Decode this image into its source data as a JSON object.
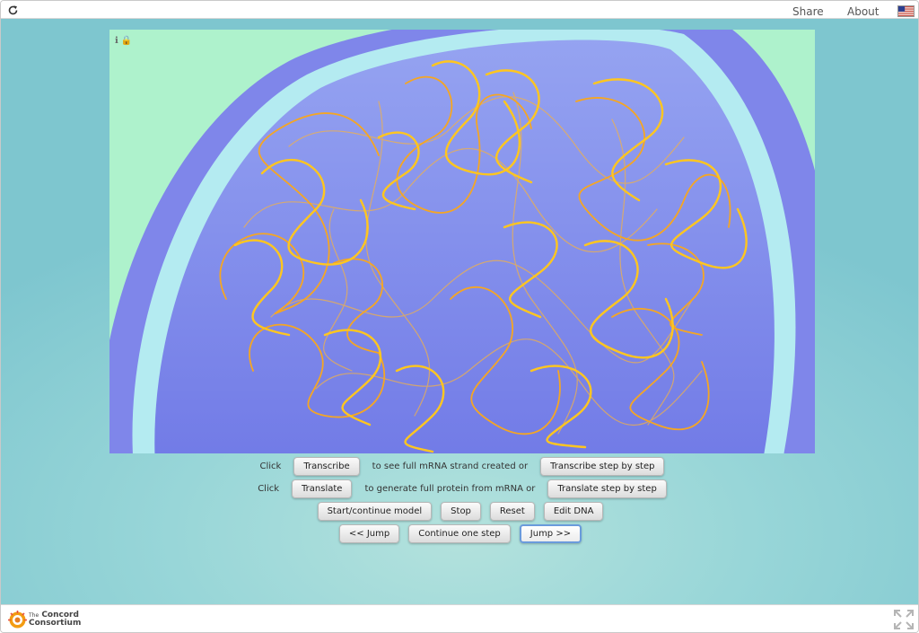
{
  "topbar": {
    "share_label": "Share",
    "about_label": "About",
    "reload_icon": "reload-icon",
    "language_icon": "us-flag-icon"
  },
  "canvas": {
    "background": "#aef2cc",
    "outer_membrane_color": "#7f86ea",
    "inner_membrane_color": "#b4ebf1",
    "nucleus_gradient": [
      "#95a3f1",
      "#7079e6"
    ],
    "dna_colors": [
      "#ffc61f",
      "#f5a623",
      "#f0b14a"
    ],
    "tool_icons": [
      "info-icon",
      "lock-icon"
    ]
  },
  "controls": {
    "row1": {
      "prefix": "Click",
      "transcribe_label": "Transcribe",
      "middle": "to see full mRNA strand created or",
      "transcribe_step_label": "Transcribe step by step"
    },
    "row2": {
      "prefix": "Click",
      "translate_label": "Translate",
      "middle": "to generate full protein from mRNA or",
      "translate_step_label": "Translate step by step"
    },
    "row3": {
      "start_label": "Start/continue model",
      "stop_label": "Stop",
      "reset_label": "Reset",
      "edit_dna_label": "Edit DNA"
    },
    "row4": {
      "jump_back_label": "<< Jump",
      "continue_step_label": "Continue one step",
      "jump_forward_label": "Jump >>"
    }
  },
  "footer": {
    "logo_top": "The",
    "logo_name_1": "Concord",
    "logo_name_2": "Consortium",
    "fullscreen_icon": "fullscreen-icon"
  }
}
